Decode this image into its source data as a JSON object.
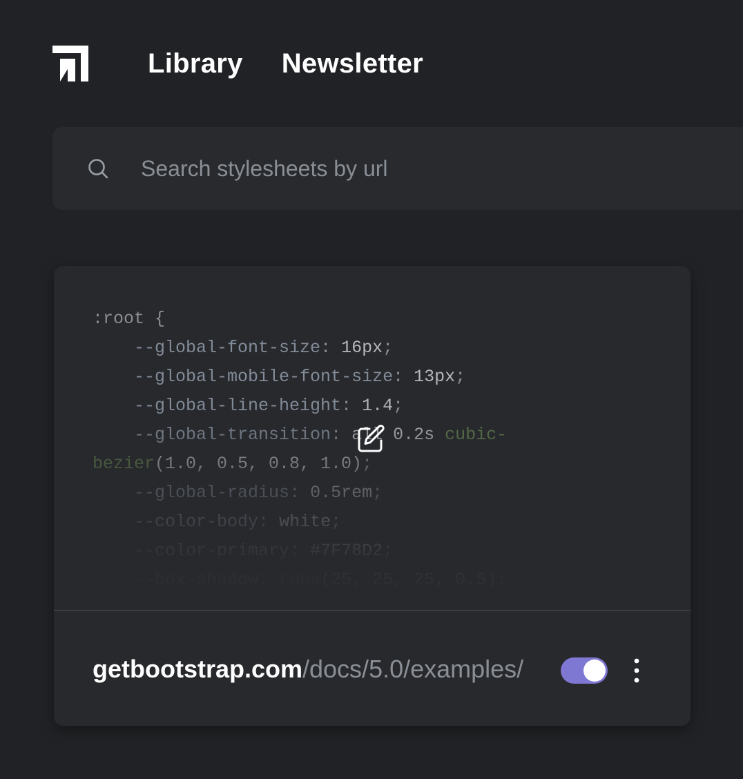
{
  "nav": {
    "logo": "logo-icon",
    "links": [
      "Library",
      "Newsletter"
    ]
  },
  "search": {
    "placeholder": "Search stylesheets by url",
    "value": "",
    "icon": "search-icon"
  },
  "card": {
    "code": {
      "selector": ":root",
      "open_brace": "{",
      "lines": [
        {
          "prop": "--global-font-size",
          "value": "16px"
        },
        {
          "prop": "--global-mobile-font-size",
          "value": "13px"
        },
        {
          "prop": "--global-line-height",
          "value": "1.4"
        },
        {
          "prop": "--global-transition",
          "value_a": "all 0.2s",
          "func": "cubic-bezier",
          "args": "(1.0, 0.5, 0.8, 1.0)"
        },
        {
          "prop": "--global-radius",
          "value": "0.5rem"
        },
        {
          "prop": "--color-body",
          "value": "white"
        },
        {
          "prop": "--color-primary",
          "value": "#7F78D2"
        },
        {
          "prop": "--box-shadow",
          "func": "rgba",
          "args": "(25, 25, 25, 0.5)"
        }
      ]
    },
    "edit_icon": "edit-icon",
    "url": {
      "domain": "getbootstrap.com",
      "path": "/docs/5.0/examples/"
    },
    "toggle": {
      "enabled": true
    },
    "more_icon": "more-vertical-icon"
  },
  "colors": {
    "background": "#212225",
    "surface": "#282a2e",
    "accent": "#7F78D2",
    "muted_text": "#8a8f96"
  }
}
